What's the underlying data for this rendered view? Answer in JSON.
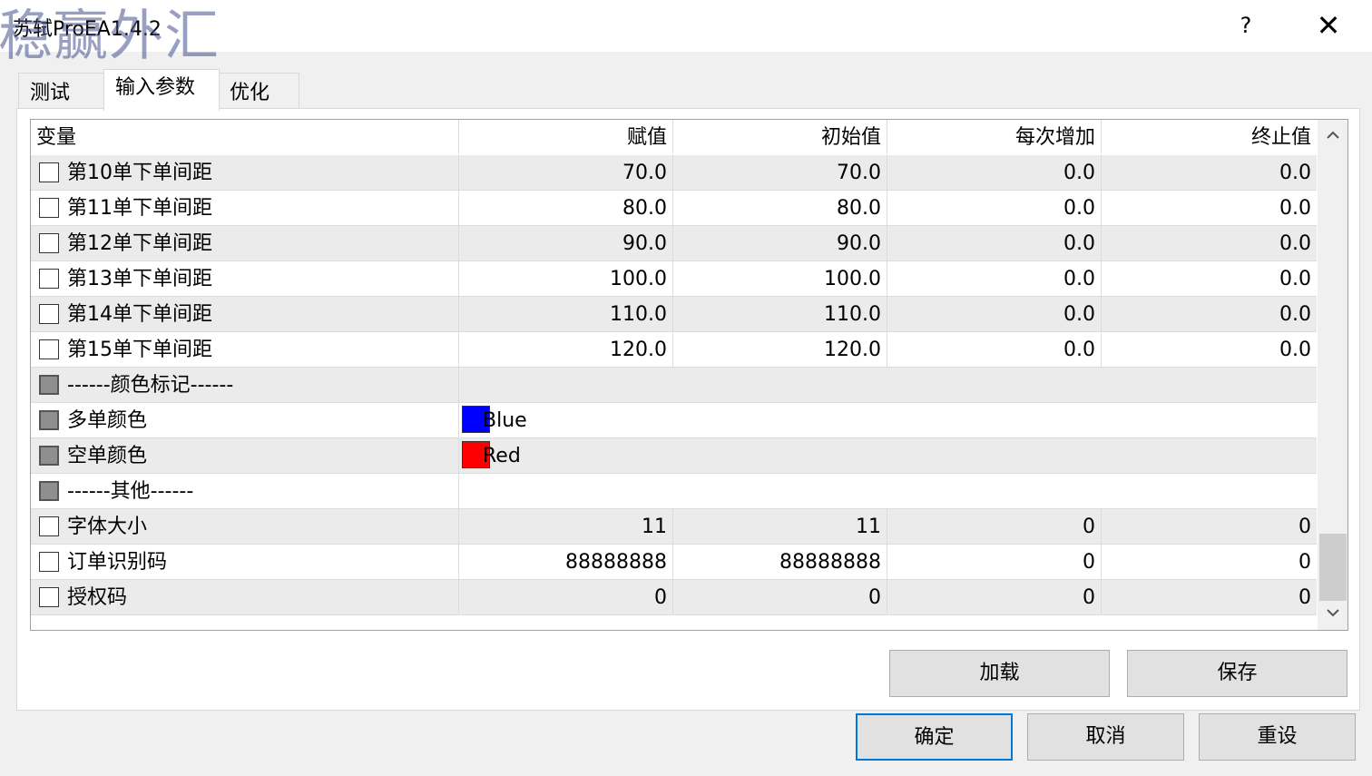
{
  "window": {
    "title": "苏轼ProEA1.4.2",
    "watermark": "稳赢外汇",
    "help_label": "?",
    "close_label": "✕"
  },
  "tabs": [
    {
      "label": "测试",
      "active": false
    },
    {
      "label": "输入参数",
      "active": true
    },
    {
      "label": "优化",
      "active": false
    }
  ],
  "grid": {
    "headers": [
      "变量",
      "赋值",
      "初始值",
      "每次增加",
      "终止值"
    ],
    "rows": [
      {
        "name": "第10单下单间距",
        "value": "70.0",
        "start": "70.0",
        "step": "0.0",
        "stop": "0.0"
      },
      {
        "name": "第11单下单间距",
        "value": "80.0",
        "start": "80.0",
        "step": "0.0",
        "stop": "0.0"
      },
      {
        "name": "第12单下单间距",
        "value": "90.0",
        "start": "90.0",
        "step": "0.0",
        "stop": "0.0"
      },
      {
        "name": "第13单下单间距",
        "value": "100.0",
        "start": "100.0",
        "step": "0.0",
        "stop": "0.0"
      },
      {
        "name": "第14单下单间距",
        "value": "110.0",
        "start": "110.0",
        "step": "0.0",
        "stop": "0.0"
      },
      {
        "name": "第15单下单间距",
        "value": "120.0",
        "start": "120.0",
        "step": "0.0",
        "stop": "0.0"
      },
      {
        "name": "------颜色标记------",
        "value": ""
      },
      {
        "name": "多单颜色",
        "value": "Blue",
        "color": "#0000ff"
      },
      {
        "name": "空单颜色",
        "value": "Red",
        "color": "#ff0000"
      },
      {
        "name": "------其他------",
        "value": ""
      },
      {
        "name": "字体大小",
        "value": "11",
        "start": "11",
        "step": "0",
        "stop": "0"
      },
      {
        "name": "订单识别码",
        "value": "88888888",
        "start": "88888888",
        "step": "0",
        "stop": "0"
      },
      {
        "name": "授权码",
        "value": "0",
        "start": "0",
        "step": "0",
        "stop": "0"
      }
    ]
  },
  "scrollbar": {
    "up_icon": "chevron-up-icon",
    "down_icon": "chevron-down-icon"
  },
  "buttons": {
    "load": "加载",
    "save": "保存",
    "ok": "确定",
    "cancel": "取消",
    "reset": "重设"
  },
  "colors": {
    "default_button_border": "#0078d7",
    "row_alt": "#ebebeb"
  }
}
